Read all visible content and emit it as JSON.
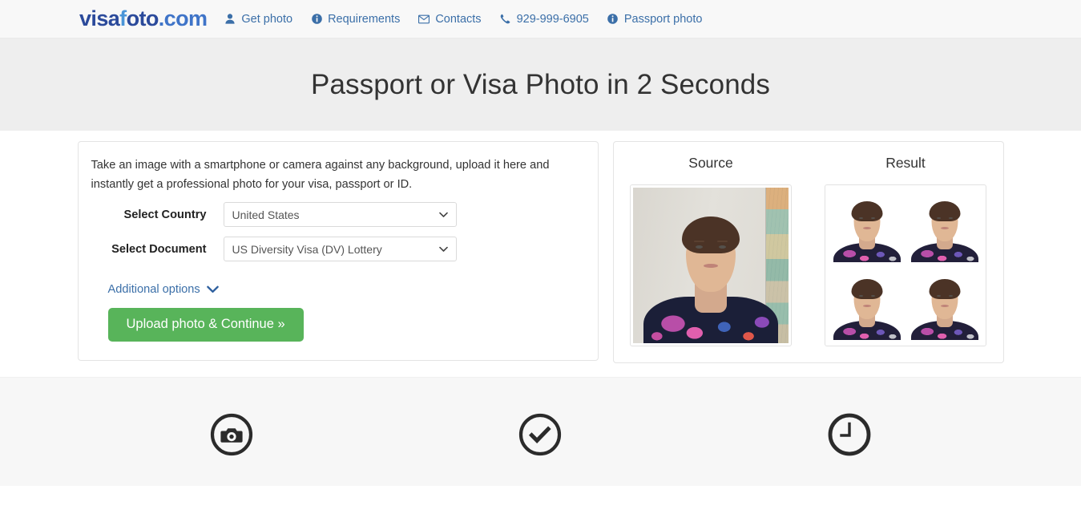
{
  "header": {
    "brand": {
      "part1": "visa",
      "part2": "f",
      "part3": "oto",
      "part4": ".com"
    },
    "nav": [
      {
        "label": "Get photo",
        "icon": "user-icon"
      },
      {
        "label": "Requirements",
        "icon": "info-icon"
      },
      {
        "label": "Contacts",
        "icon": "envelope-icon"
      },
      {
        "label": "929-999-6905",
        "icon": "phone-icon"
      },
      {
        "label": "Passport photo",
        "icon": "info-icon"
      }
    ]
  },
  "hero": {
    "title": "Passport or Visa Photo in 2 Seconds"
  },
  "form": {
    "intro": "Take an image with a smartphone or camera against any background, upload it here and instantly get a professional photo for your visa, passport or ID.",
    "country_label": "Select Country",
    "country_value": "United States",
    "document_label": "Select Document",
    "document_value": "US Diversity Visa (DV) Lottery",
    "additional_options_label": "Additional options",
    "upload_button_label": "Upload photo & Continue »"
  },
  "preview": {
    "source_title": "Source",
    "result_title": "Result"
  },
  "features": [
    {
      "icon": "camera-circle-icon"
    },
    {
      "icon": "check-circle-icon"
    },
    {
      "icon": "clock-circle-icon"
    }
  ],
  "colors": {
    "brand_dark": "#2b4a9b",
    "brand_light": "#4a95d8",
    "link": "#3b6fa8",
    "button_green": "#58b45a",
    "hero_bg": "#eeeeee",
    "header_bg": "#f8f8f8",
    "features_bg": "#f7f7f7"
  }
}
